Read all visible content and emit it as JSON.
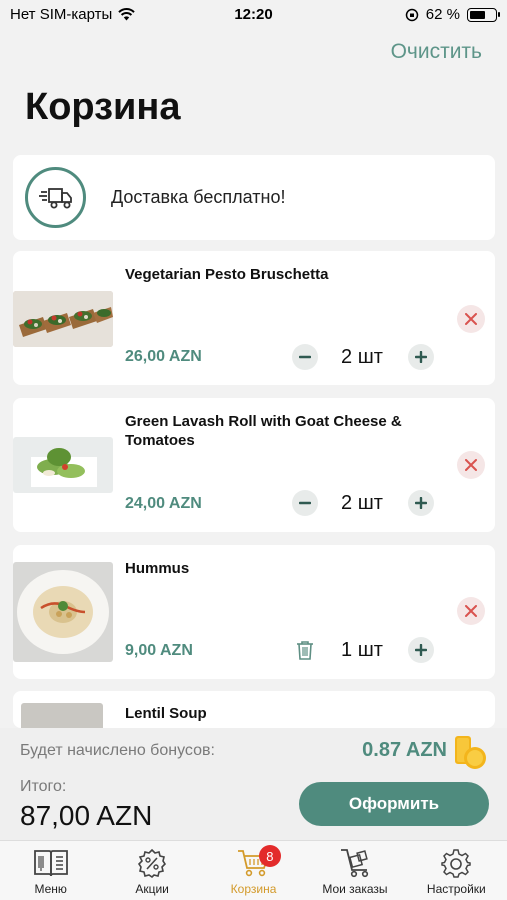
{
  "status_bar": {
    "carrier": "Нет SIM-карты",
    "time": "12:20",
    "battery": "62 %",
    "battery_level": 0.62
  },
  "header": {
    "clear_label": "Очистить",
    "title": "Корзина"
  },
  "delivery": {
    "text": "Доставка бесплатно!"
  },
  "items": [
    {
      "name": "Vegetarian Pesto Bruschetta",
      "price": "26,00 AZN",
      "qty": "2 шт"
    },
    {
      "name": "Green Lavash Roll with Goat Cheese & Tomatoes",
      "price": "24,00 AZN",
      "qty": "2 шт"
    },
    {
      "name": "Hummus",
      "price": "9,00 AZN",
      "qty": "1 шт"
    },
    {
      "name": "Lentil Soup"
    }
  ],
  "summary": {
    "bonus_label": "Будет начислено бонусов:",
    "bonus_value": "0.87 AZN",
    "total_label": "Итого:",
    "total_value": "87,00 AZN",
    "checkout_label": "Оформить"
  },
  "tabbar": {
    "tabs": [
      {
        "label": "Меню",
        "icon": "menu-book-icon"
      },
      {
        "label": "Акции",
        "icon": "discount-badge-icon"
      },
      {
        "label": "Корзина",
        "icon": "cart-icon",
        "active": true,
        "badge": "8"
      },
      {
        "label": "Мои заказы",
        "icon": "orders-cart-icon"
      },
      {
        "label": "Настройки",
        "icon": "gear-icon"
      }
    ]
  },
  "colors": {
    "accent": "#4f8b7e",
    "active_tab": "#d39a2a",
    "badge": "#e32b2b",
    "remove": "#d9534f"
  }
}
